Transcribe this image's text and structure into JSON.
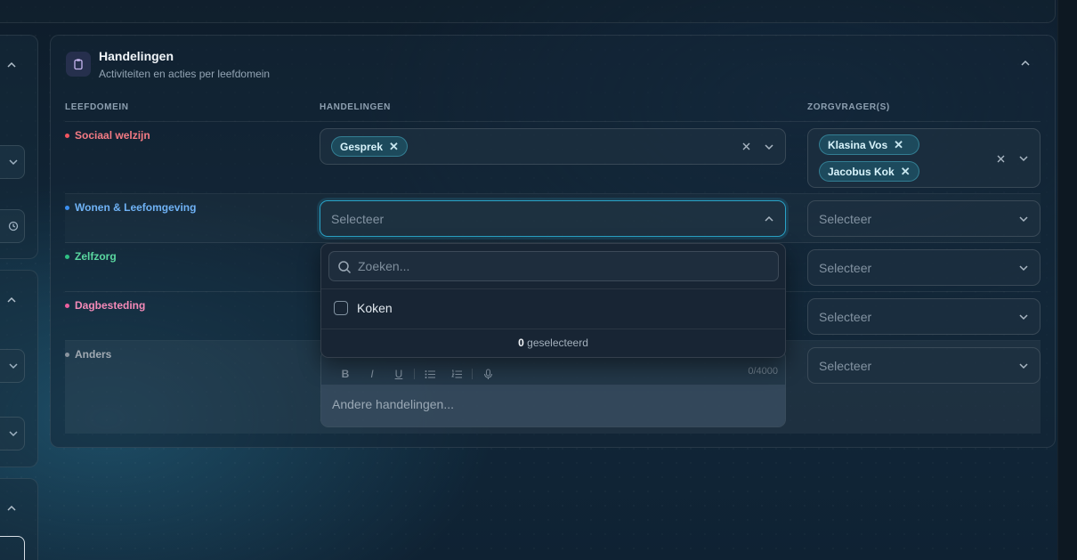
{
  "panel": {
    "title": "Handelingen",
    "subtitle": "Activiteiten en acties per leefdomein"
  },
  "columns": {
    "leefdomein": "LEEFDOMEIN",
    "handelingen": "HANDELINGEN",
    "zorgvragers": "ZORGVRAGER(S)"
  },
  "rows": [
    {
      "label": "Sociaal welzijn",
      "color": "#f47b84"
    },
    {
      "label": "Wonen & Leefomgeving",
      "color": "#6fb2f5"
    },
    {
      "label": "Zelfzorg",
      "color": "#5ad7a0"
    },
    {
      "label": "Dagbesteding",
      "color": "#f58ab8"
    },
    {
      "label": "Anders",
      "color": "#a0a9b2"
    }
  ],
  "row1": {
    "handelingen_tags": [
      "Gesprek"
    ],
    "zorgvragers_tags": [
      "Klasina Vos",
      "Jacobus Kok"
    ]
  },
  "placeholder": "Selecteer",
  "dropdown": {
    "search_placeholder": "Zoeken...",
    "option": "Koken",
    "selected_count": "0",
    "selected_label": "geselecteerd"
  },
  "editor": {
    "counter": "0/4000",
    "placeholder": "Andere handelingen...",
    "tools": [
      "B",
      "I",
      "U"
    ]
  },
  "colors": {
    "accent": "#2aa3c7",
    "tag_bg": "#226e82"
  }
}
